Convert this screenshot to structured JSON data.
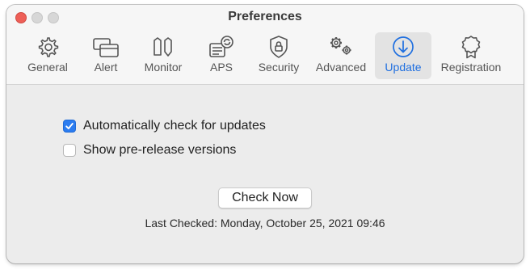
{
  "window": {
    "title": "Preferences"
  },
  "toolbar": {
    "items": [
      {
        "label": "General",
        "icon": "gear-icon",
        "selected": false
      },
      {
        "label": "Alert",
        "icon": "alert-windows-icon",
        "selected": false
      },
      {
        "label": "Monitor",
        "icon": "monitor-icon",
        "selected": false
      },
      {
        "label": "APS",
        "icon": "aps-icon",
        "selected": false
      },
      {
        "label": "Security",
        "icon": "shield-lock-icon",
        "selected": false
      },
      {
        "label": "Advanced",
        "icon": "gears-icon",
        "selected": false
      },
      {
        "label": "Update",
        "icon": "download-arrow-icon",
        "selected": true
      },
      {
        "label": "Registration",
        "icon": "award-badge-icon",
        "selected": false
      }
    ],
    "accent_color": "#1f6fe0"
  },
  "update": {
    "auto_check_label": "Automatically check for updates",
    "auto_check_checked": true,
    "prerelease_label": "Show pre-release versions",
    "prerelease_checked": false,
    "check_now_label": "Check Now",
    "last_checked": "Last Checked: Monday, October 25, 2021 09:46"
  }
}
